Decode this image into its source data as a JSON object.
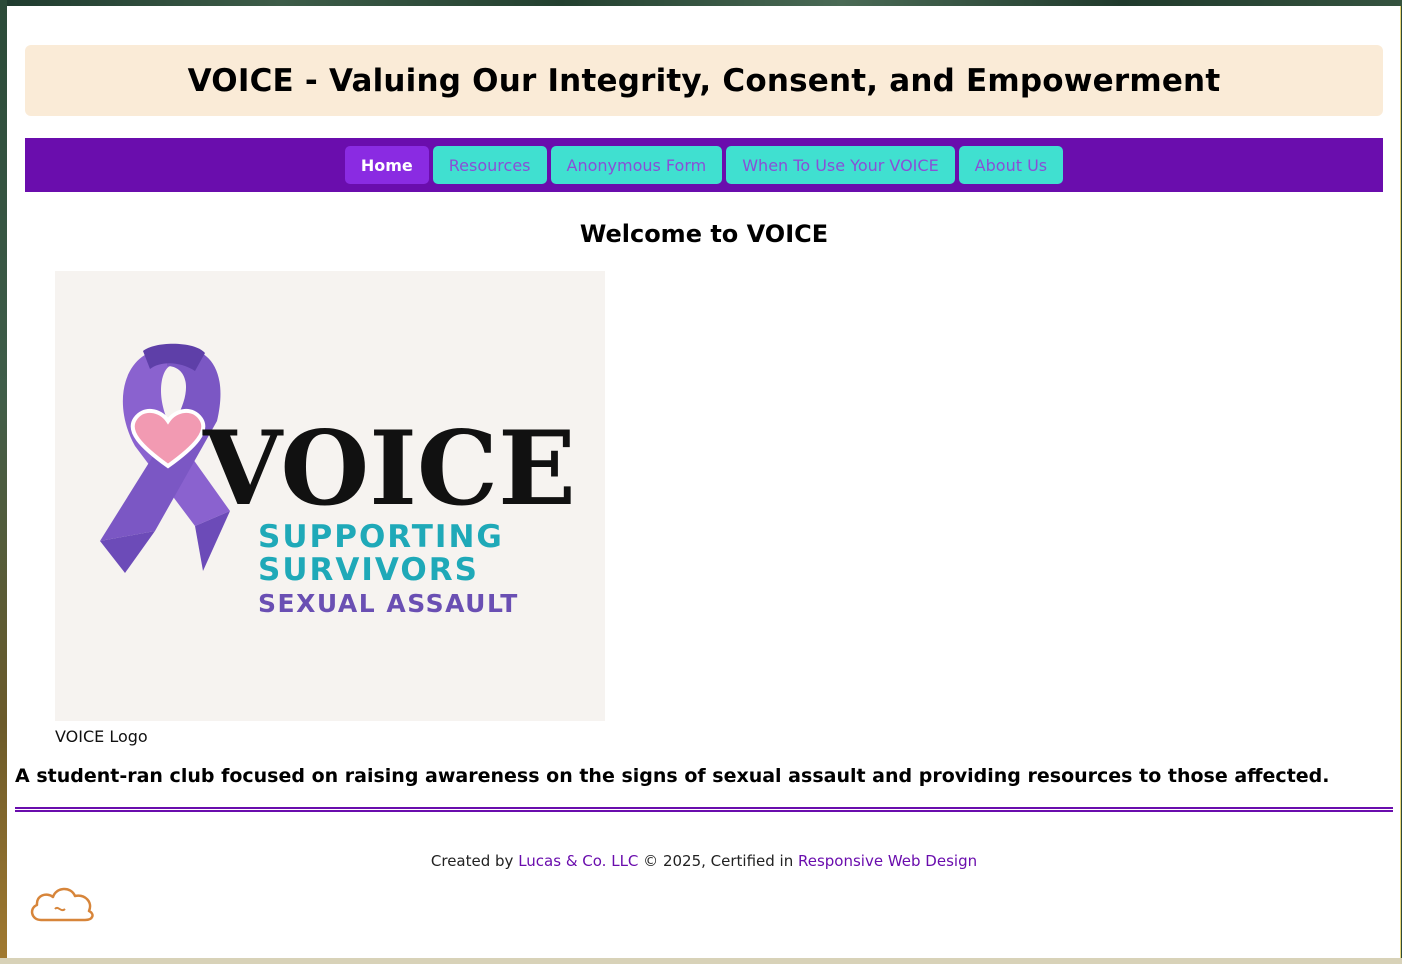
{
  "header": {
    "title": "VOICE - Valuing Our Integrity, Consent, and Empowerment"
  },
  "nav": {
    "items": [
      {
        "label": "Home",
        "active": true
      },
      {
        "label": "Resources"
      },
      {
        "label": "Anonymous Form"
      },
      {
        "label": "When To Use Your VOICE"
      },
      {
        "label": "About Us"
      }
    ]
  },
  "main": {
    "welcome": "Welcome to VOICE",
    "logo": {
      "wordmark": "VOICE",
      "line1": "SUPPORTING",
      "line2": "SURVIVORS",
      "line3": "SEXUAL ASSAULT"
    },
    "logo_caption": "VOICE Logo",
    "tagline": "A student-ran club focused on raising awareness on the signs of sexual assault and providing resources to those affected."
  },
  "footer": {
    "prefix": "Created by ",
    "company": "Lucas & Co. LLC",
    "middle": " © 2025, Certified in ",
    "cert": "Responsive Web Design"
  },
  "colors": {
    "nav_bg": "#6a0dad",
    "nav_button": "#40e0d0",
    "nav_active": "#8a2be2",
    "header_bg": "#faebd7",
    "ribbon": "#7b57c4",
    "heart": "#f29ab2",
    "teal_text": "#1fa9b8",
    "purple_text": "#6a4fb3"
  },
  "icons": {
    "floating": "cloud-icon"
  }
}
